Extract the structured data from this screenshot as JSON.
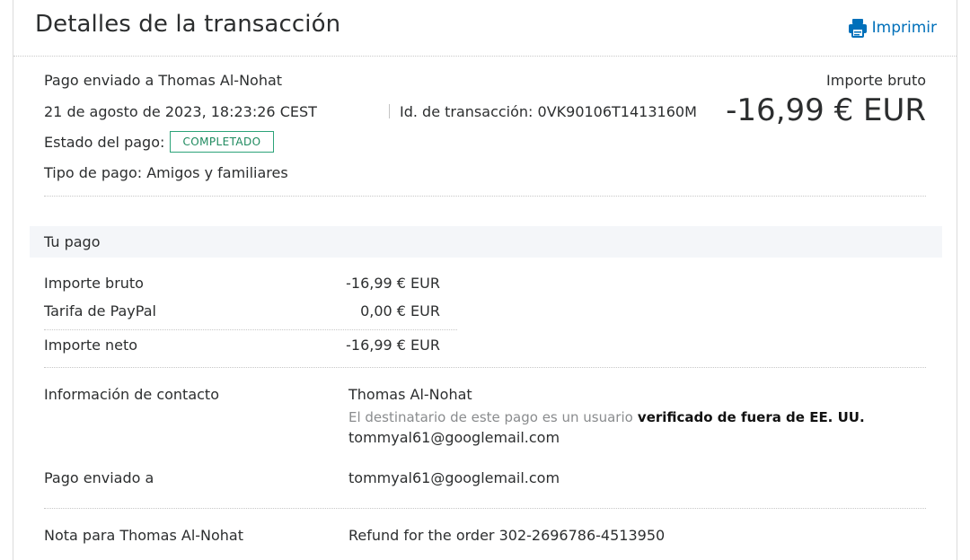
{
  "header": {
    "title": "Detalles de la transacción",
    "print_label": "Imprimir",
    "print_icon": "printer-icon",
    "accent_color": "#0070ba"
  },
  "summary": {
    "sent_to": "Pago enviado a Thomas Al-Nohat",
    "datetime": "21 de agosto de 2023, 18:23:26 CEST",
    "transaction_id": "Id. de transacción: 0VK90106T1413160M",
    "payment_status_label": "Estado del pago:",
    "payment_status_badge": "COMPLETADO",
    "payment_type": "Tipo de pago: Amigos y familiares",
    "gross_label": "Importe bruto",
    "gross_amount": "-16,99 € EUR",
    "status_color": "#2ca379"
  },
  "your_payment": {
    "section_title": "Tu pago",
    "rows": [
      {
        "label": "Importe bruto",
        "value": "-16,99 € EUR"
      },
      {
        "label": "Tarifa de PayPal",
        "value": "0,00 € EUR"
      },
      {
        "label": "Importe neto",
        "value": "-16,99 € EUR"
      }
    ]
  },
  "contact": {
    "label": "Información de contacto",
    "name": "Thomas Al-Nohat",
    "note_prefix": "El destinatario de este pago es un usuario",
    "note_bold": "verificado de fuera de EE. UU.",
    "email": "tommyal61@googlemail.com"
  },
  "sent_to_row": {
    "label": "Pago enviado a",
    "value": "tommyal61@googlemail.com"
  },
  "note_row": {
    "label": "Nota para Thomas Al-Nohat",
    "value": "Refund for the order 302-2696786-4513950"
  }
}
